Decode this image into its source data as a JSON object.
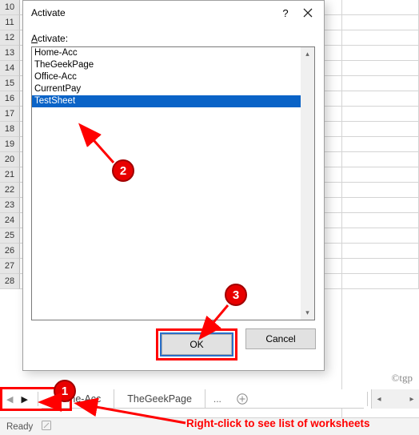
{
  "grid": {
    "row_start": 10,
    "row_end": 28
  },
  "dialog": {
    "title": "Activate",
    "label_prefix": "A",
    "label_rest": "ctivate:",
    "items": [
      "Home-Acc",
      "TheGeekPage",
      "Office-Acc",
      "CurrentPay",
      "TestSheet"
    ],
    "selected_index": 4,
    "ok": "OK",
    "cancel": "Cancel"
  },
  "tabs": {
    "visible": [
      "Home-Acc",
      "TheGeekPage"
    ],
    "ellipsis": "...",
    "add_icon": "+"
  },
  "status": {
    "ready": "Ready"
  },
  "watermark": "©tgp",
  "annotations": {
    "b1": "1",
    "b2": "2",
    "b3": "3",
    "tip": "Right-click to see list of worksheets"
  }
}
